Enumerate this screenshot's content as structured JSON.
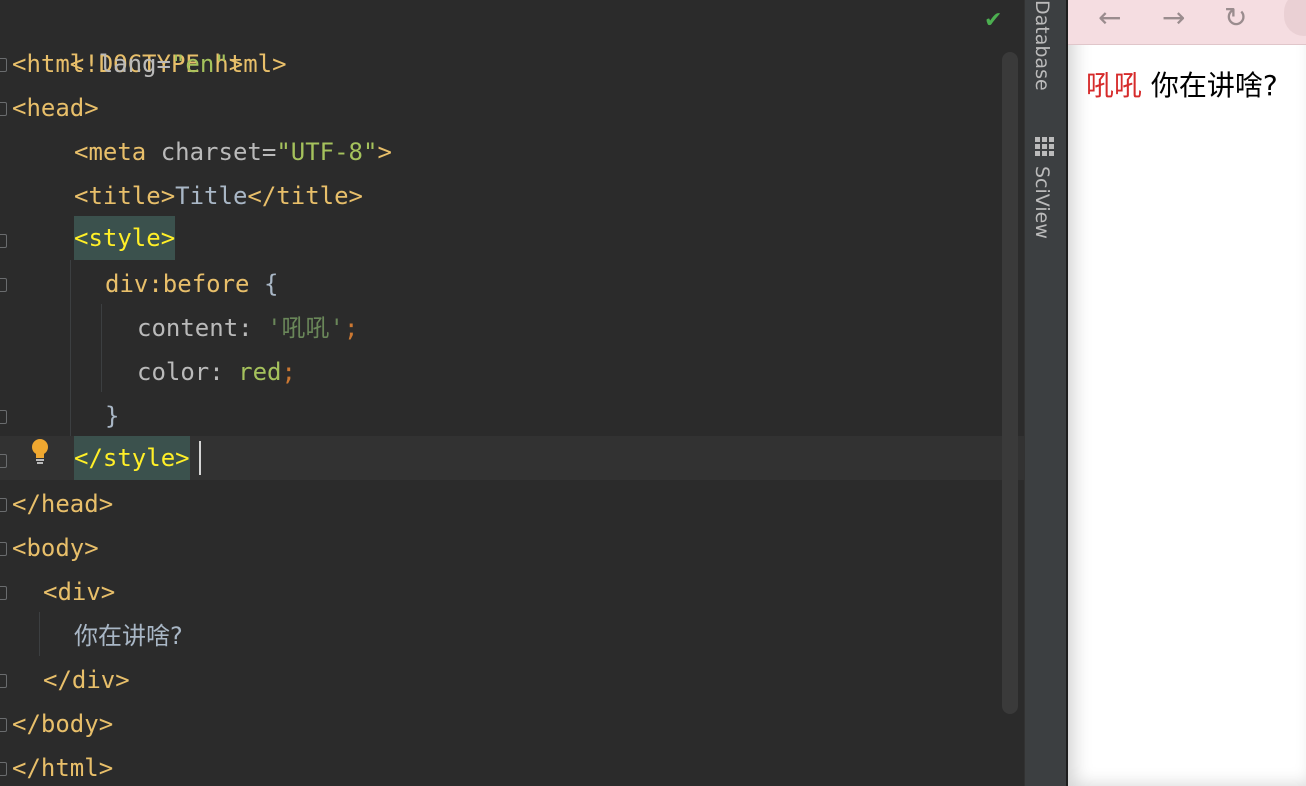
{
  "editor": {
    "lines": [
      [
        "<!DOCTYPE html>"
      ],
      [
        "<html ",
        "lang",
        "=",
        "\"en\"",
        ">"
      ],
      [
        "<head>"
      ],
      [
        "<meta ",
        "charset",
        "=",
        "\"UTF-8\"",
        ">"
      ],
      [
        "<title>",
        "Title",
        "</title>"
      ],
      [
        "<style>"
      ],
      [
        "div",
        ":before",
        " {"
      ],
      [
        "content",
        ": ",
        "'吼吼'",
        ";"
      ],
      [
        "color",
        ": ",
        "red",
        ";"
      ],
      [
        "}"
      ],
      [
        "</style>"
      ],
      [
        "</head>"
      ],
      [
        "<body>"
      ],
      [
        "<div>"
      ],
      [
        "你在讲啥?"
      ],
      [
        "</div>"
      ],
      [
        "</body>"
      ],
      [
        "</html>"
      ]
    ]
  },
  "right_strip": {
    "database_label": "Database",
    "sciview_label": "SciView"
  },
  "browser": {
    "back": "←",
    "forward": "→",
    "reload": "↻",
    "before_text": "吼吼",
    "div_text": " 你在讲啥?"
  },
  "icons": {
    "check": "checkmark-icon",
    "bulb": "lightbulb-icon"
  }
}
